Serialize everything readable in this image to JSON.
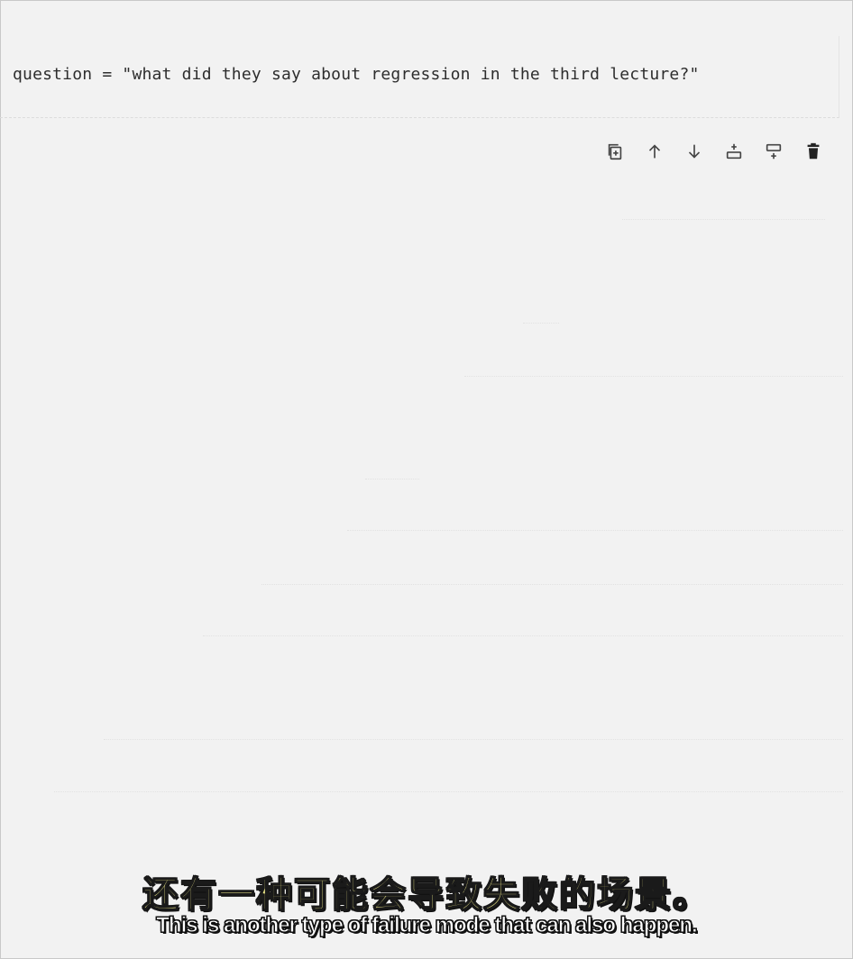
{
  "cell": {
    "code": "question = \"what did they say about regression in the third lecture?\""
  },
  "toolbar": {
    "buttons": [
      {
        "name": "duplicate-cell",
        "icon": "copy-icon"
      },
      {
        "name": "move-up",
        "icon": "arrow-up-icon"
      },
      {
        "name": "move-down",
        "icon": "arrow-down-icon"
      },
      {
        "name": "insert-cell-above",
        "icon": "insert-above-icon"
      },
      {
        "name": "insert-cell-below",
        "icon": "insert-below-icon"
      },
      {
        "name": "delete-cell",
        "icon": "trash-icon"
      }
    ]
  },
  "subtitles": {
    "zh": "还有一种可能会导致失败的场景。",
    "en": "This is another type of failure mode that can also happen."
  },
  "colors": {
    "background": "#f2f2f2",
    "code_text": "#2d2d2d",
    "subtitle_zh": "#f4ef8c",
    "subtitle_en": "#ffffff"
  }
}
